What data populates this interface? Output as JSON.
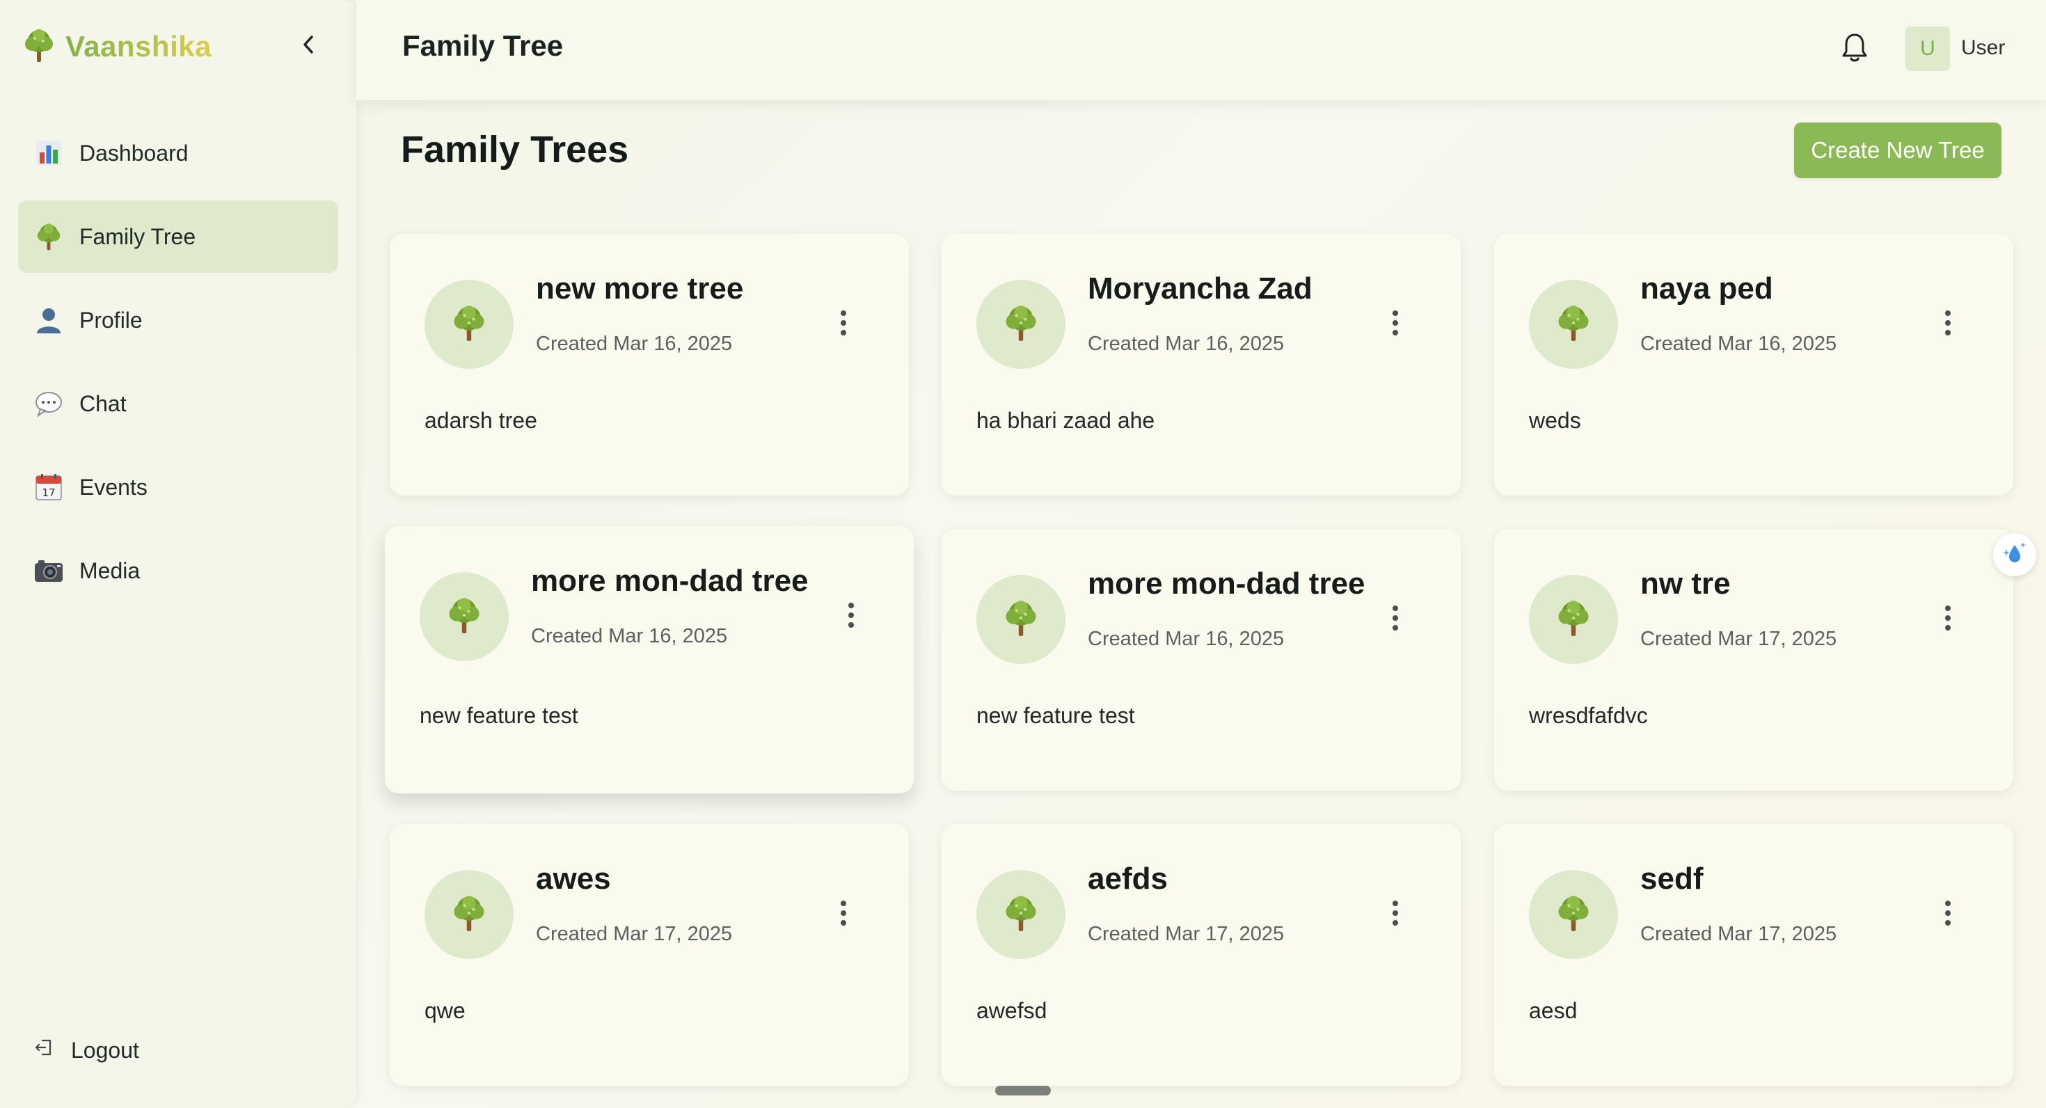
{
  "sidebar": {
    "brand": "Vaanshika",
    "items": [
      {
        "label": "Dashboard",
        "icon": "bar-chart-icon",
        "active": false
      },
      {
        "label": "Family Tree",
        "icon": "tree-icon",
        "active": true
      },
      {
        "label": "Profile",
        "icon": "user-icon",
        "active": false
      },
      {
        "label": "Chat",
        "icon": "speech-bubble-icon",
        "active": false
      },
      {
        "label": "Events",
        "icon": "calendar-icon",
        "active": false
      },
      {
        "label": "Media",
        "icon": "camera-icon",
        "active": false
      }
    ],
    "logout_label": "Logout"
  },
  "header": {
    "title": "Family Tree",
    "avatar_letter": "U",
    "user_name": "User"
  },
  "main": {
    "heading": "Family Trees",
    "create_button": "Create New Tree",
    "trees": [
      {
        "name": "new more tree",
        "created": "Created Mar 16, 2025",
        "description": "adarsh tree"
      },
      {
        "name": "Moryancha Zad",
        "created": "Created Mar 16, 2025",
        "description": "ha bhari zaad ahe"
      },
      {
        "name": "naya ped",
        "created": "Created Mar 16, 2025",
        "description": "weds"
      },
      {
        "name": "more mon-dad tree",
        "created": "Created Mar 16, 2025",
        "description": "new feature test"
      },
      {
        "name": "more mon-dad tree",
        "created": "Created Mar 16, 2025",
        "description": "new feature test"
      },
      {
        "name": "nw tre",
        "created": "Created Mar 17, 2025",
        "description": "wresdfafdvc"
      },
      {
        "name": "awes",
        "created": "Created Mar 17, 2025",
        "description": "qwe"
      },
      {
        "name": "aefds",
        "created": "Created Mar 17, 2025",
        "description": "awefsd"
      },
      {
        "name": "sedf",
        "created": "Created Mar 17, 2025",
        "description": "aesd"
      }
    ]
  },
  "colors": {
    "accent": "#8bb955",
    "active_nav_bg": "#dfe9cc",
    "card_bg": "#fbfaee"
  }
}
